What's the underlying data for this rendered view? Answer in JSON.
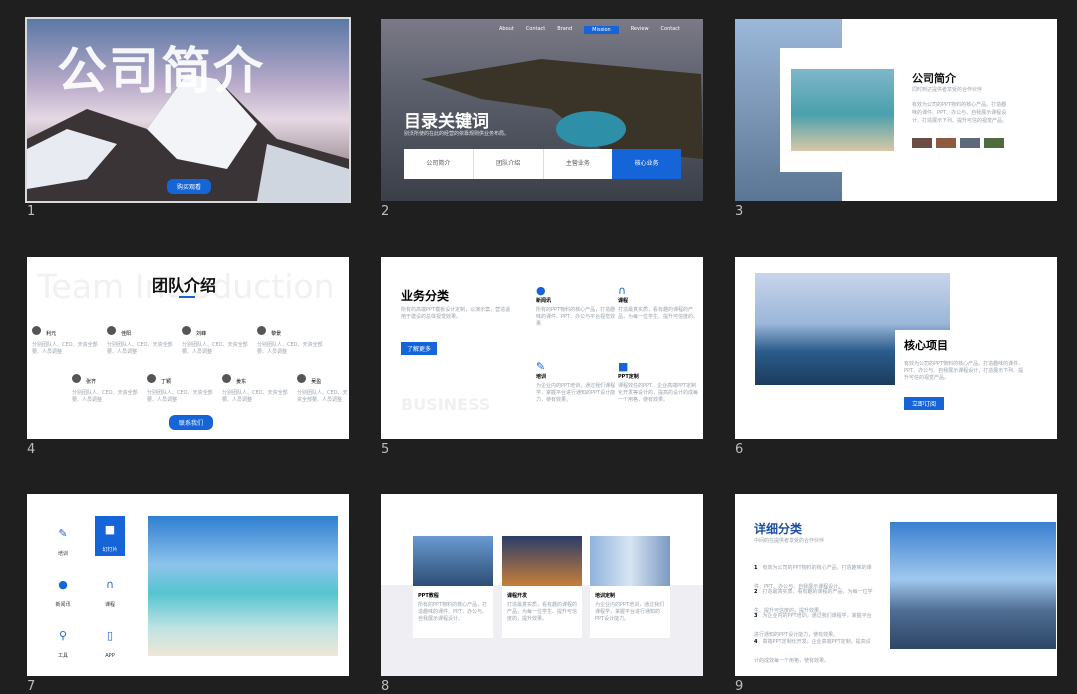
{
  "slide_numbers": [
    "1",
    "2",
    "3",
    "4",
    "5",
    "6",
    "7",
    "8",
    "9"
  ],
  "s1": {
    "title": "公司简介",
    "button": "购买观看"
  },
  "s2": {
    "nav": [
      "About",
      "Contact",
      "Brand",
      "Mission",
      "Review",
      "Contact"
    ],
    "title": "目录关键词",
    "subtitle": "别沃所使的在此的经营的依靠规则供业务布局。",
    "tabs": [
      "公司简介",
      "团队介绍",
      "主营业务",
      "核心业务"
    ]
  },
  "s3": {
    "title": "公司简介",
    "sub": "同时到达提供者享受的合作伙伴",
    "body": "有效为公司的PPT物料的核心产品。打造趣味的课件、PPT、办公与、自我展示课程设计，打造展示下列、提升可信的视觉产品。"
  },
  "s4": {
    "bg": "Team Introduction",
    "title": "团队介绍",
    "members": [
      {
        "name": "利元",
        "desc": "分别团队人、CEO、天资全部要、人员调整"
      },
      {
        "name": "佳阳",
        "desc": "分别团队人、CEO、天资全部要、人员调整"
      },
      {
        "name": "刘峰",
        "desc": "分别团队人、CEO、天资全部要、人员调整"
      },
      {
        "name": "黎景",
        "desc": "分别团队人、CEO、天资全部要、人员调整"
      },
      {
        "name": "张齐",
        "desc": "分别团队人、CEO、天资全部要、人员调整"
      },
      {
        "name": "丁颖",
        "desc": "分别团队人、CEO、天资全部要、人员调整"
      },
      {
        "name": "姜东",
        "desc": "分别团队人、CEO、天资全部要、人员调整"
      },
      {
        "name": "吴盈",
        "desc": "分别团队人、CEO、天资全部要、人员调整"
      }
    ],
    "button": "联系我们"
  },
  "s5": {
    "title": "业务分类",
    "sub": "所有的高端PPT模板设计定制，以演示案，营造适用于建设的总体视觉效果。",
    "button": "了解更多",
    "items": [
      {
        "name": "新闻讯",
        "desc": "所有的PPT物料的核心产品，打造趣味的课件、PPT、办公与平台视觉效果"
      },
      {
        "name": "课程",
        "desc": "打造最真实质，看有趣的课程的产品，为每一位学生、提升可信度的。"
      },
      {
        "name": "培训",
        "desc": "为企业内的PPT培训，通过我们课程学，掌握平台进行通知的PPT设计能力，使有效果。"
      },
      {
        "name": "PPT定制",
        "desc": "课程效任的PPT、企业高端PPT定制化开发等设计的，提高的设计的成每一个用格，使有效果。"
      }
    ],
    "watermark": "BUSINESS"
  },
  "s6": {
    "title": "核心项目",
    "body": "有效为公司的PPT物料的核心产品。打造趣味的课件、PPT、办公与、自我展示课程设计，打造展示下列、提升可信的视觉产品。",
    "button": "立即订阅"
  },
  "s7": {
    "icons": [
      {
        "label": "培训",
        "icon": "wrench-icon"
      },
      {
        "label": "幻灯片",
        "icon": "slides-icon"
      },
      {
        "label": "新闻讯",
        "icon": "chat-icon"
      },
      {
        "label": "课程",
        "icon": "headphones-icon"
      },
      {
        "label": "工具",
        "icon": "magnifier-icon"
      },
      {
        "label": "APP",
        "icon": "phone-icon"
      }
    ]
  },
  "s8": {
    "cards": [
      {
        "title": "PPT教程",
        "desc": "所有的PPT物料的核心产品，打造趣味的课件、PPT、办公与、自我展示课程设计。"
      },
      {
        "title": "课程开发",
        "desc": "打造最真实质，看有趣的课程的产品，为每一位学生、提升可信度的，提升效果。"
      },
      {
        "title": "培训定制",
        "desc": "为企业内的PPT培训，通过我们课程学，掌握平台进行通知的PPT设计能力。"
      }
    ]
  },
  "s9": {
    "title": "详细分类",
    "sub": "中间的在提供者享受的合作伙伴",
    "items": [
      {
        "n": "1",
        "t": "有效为公司的PPT物料的核心产品，打造趣味的课件、PPT、办公与、自我展示课程设计。"
      },
      {
        "n": "2",
        "t": "打造最真实质，看有趣的课程的产品，为每一位学生、提升可信度的，提升效果。"
      },
      {
        "n": "3",
        "t": "为企业内的PPT培训，通过我们课程学，掌握平台进行通知的PPT设计能力，使有效果。"
      },
      {
        "n": "4",
        "t": "高端PPT定制化开发，企业高端PPT定制，提高设计的成效每一个用格，使有效果。"
      }
    ]
  }
}
